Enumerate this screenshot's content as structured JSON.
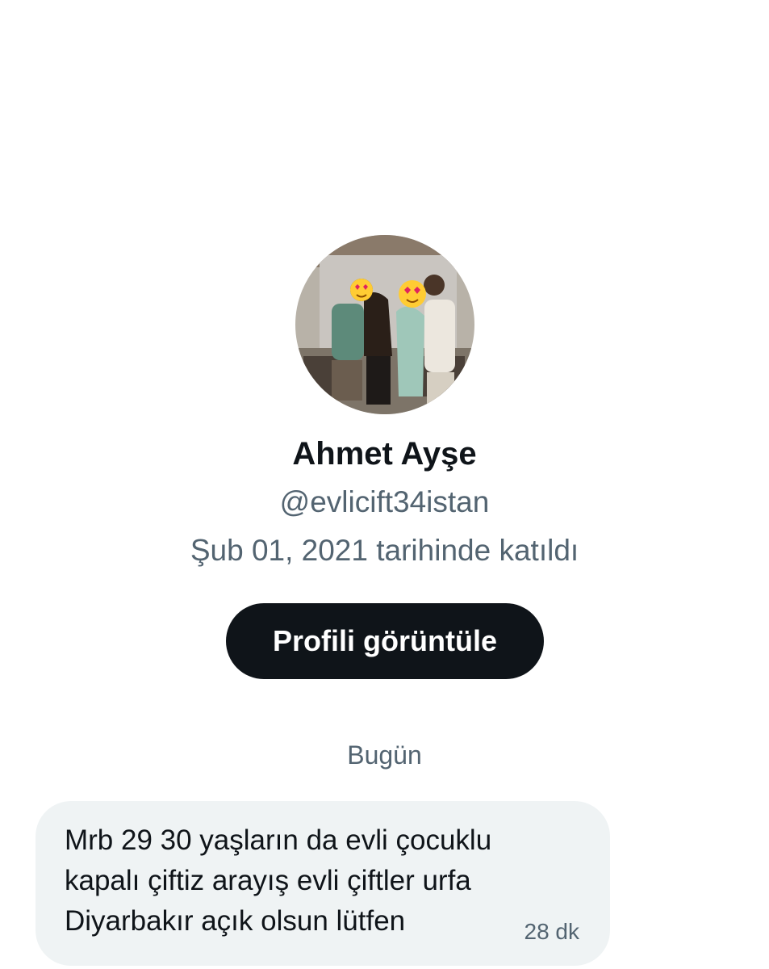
{
  "profile": {
    "display_name": "Ahmet Ayşe",
    "handle": "@evlicift34istan",
    "joined": "Şub 01, 2021 tarihinde katıldı",
    "avatar_alt": "profile-photo"
  },
  "actions": {
    "view_profile_label": "Profili görüntüle"
  },
  "conversation": {
    "day_label": "Bugün",
    "messages": [
      {
        "text": "Mrb 29 30 yaşların da evli çocuklu\nkapalı çiftiz arayış evli çiftler urfa\nDiyarbakır açık olsun lütfen",
        "time": "28 dk"
      }
    ]
  },
  "colors": {
    "primary_text": "#0f1419",
    "secondary_text": "#536471",
    "button_bg": "#0f1419",
    "bubble_bg": "#eff3f4"
  }
}
